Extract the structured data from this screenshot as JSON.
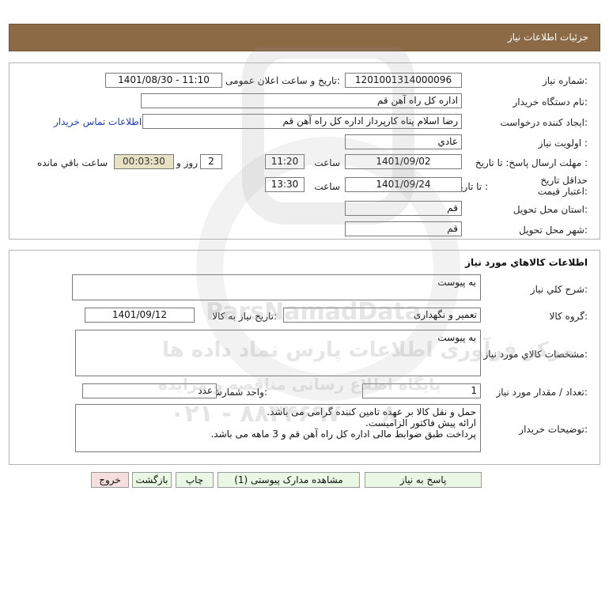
{
  "header": {
    "title": "جزئیات اطلاعات نیاز"
  },
  "need": {
    "number_label": "شماره نیاز:",
    "number": "1201001314000096",
    "announce_label": "تاریخ و ساعت اعلان عمومی:",
    "announce_value": "1401/08/30 - 11:10",
    "buyer_label": "نام دستگاه خریدار:",
    "buyer_value": "اداره کل  راه آهن قم",
    "creator_label": "ایجاد کننده درخواست:",
    "creator_value": "رضا اسلام پناه کارپرداز اداره کل  راه آهن قم",
    "contact_link": "اطلاعات تماس خریدار",
    "priority_label": "اولویت نیاز :",
    "priority_value": "عادي",
    "deadline_label": "مهلت ارسال پاسخ:  تا تاریخ :",
    "deadline_date": "1401/09/02",
    "time_label": "ساعت",
    "deadline_time": "11:20",
    "days_value": "2",
    "days_label": "روز و",
    "remaining_time": "00:03:30",
    "remaining_label": "ساعت باقي مانده",
    "validity_label": "حداقل تاریخ اعتبار قیمت:",
    "validity_to_label": "تا تاریخ :",
    "validity_date": "1401/09/24",
    "validity_time": "13:30",
    "province_label": "استان محل تحویل:",
    "province_value": "قم",
    "city_label": "شهر محل تحویل:",
    "city_value": "قم"
  },
  "goods": {
    "section_title": "اطلاعات کالاهاي مورد نياز",
    "summary_label": "شرح كلي نياز:",
    "summary_value": "به پیوست",
    "group_label": "گروه کالا:",
    "group_value": "تعمیر و نگهداری",
    "need_date_label": "تاریخ نیاز به کالا:",
    "need_date_value": "1401/09/12",
    "spec_label": "مشخصات کالاي مورد نياز:",
    "spec_value": "به پیوست",
    "qty_label": "تعداد / مقدار مورد نیاز:",
    "qty_value": "1",
    "unit_label": "واحد شمارش:",
    "unit_value": "عدد",
    "notes_label": "توضیحات خریدار:",
    "notes_lines": {
      "l1": "حمل و نقل کالا بر عهده تامین کننده گرامی می باشد.",
      "l2": "ارائه پیش فاکتور الزامیست.",
      "l3": "پرداخت طبق ضوابط مالی اداره کل راه آهن قم و 3 ماهه می باشد."
    }
  },
  "buttons": {
    "reply": "پاسخ به نیاز",
    "docs": "مشاهده مدارک پیوستی (1)",
    "print": "چاپ",
    "back": "بازگشت",
    "exit": "خروج"
  },
  "watermark": {
    "brand": "ParsNamadData",
    "line1": "مرکز فرآوری اطلاعات پارس نماد داده ها",
    "line2": "پایگاه اطلاع رسانی مناقصه و مزایده",
    "phone": "۰۲۱ - ۸۸۳۴۶۹۷۰ - ۸"
  },
  "colors": {
    "header": "#8c6a46",
    "timer": "#e8e2c4",
    "link": "#1a3fb8",
    "button": "#e9f7e4",
    "exit_button": "#f7dede"
  }
}
